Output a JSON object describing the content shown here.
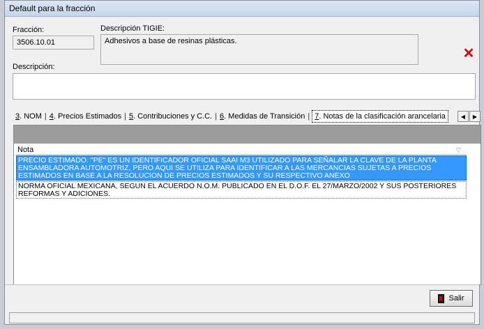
{
  "window": {
    "title": "Default para la fracción"
  },
  "fields": {
    "fraccion_label": "Fracción:",
    "fraccion_value": "3506.10.01",
    "descripcion_tigie_label": "Descripción TIGIE:",
    "descripcion_tigie_value": "Adhesivos a base de resinas plásticas.",
    "descripcion_label": "Descripción:",
    "descripcion_value": ""
  },
  "tabs": [
    {
      "key": "3",
      "label": ". NOM"
    },
    {
      "key": "4",
      "label": ". Precios Estimados"
    },
    {
      "key": "5",
      "label": ". Contribuciones y C.C."
    },
    {
      "key": "6",
      "label": ". Medidas de Transición"
    },
    {
      "key": "7",
      "label": ". Notas de la clasificación arancelaria"
    }
  ],
  "icons": {
    "close": "close-icon",
    "scroll_left": "arrow-left-icon",
    "scroll_right": "arrow-right-icon",
    "exit": "door-icon"
  },
  "grid": {
    "column_header": "Nota",
    "rows": [
      "PRECIO ESTIMADO.    \"PE\" ES UN IDENTIFICADOR OFICIAL SAAI M3 UTILIZADO PARA  SEÑALAR LA CLAVE DE LA PLANTA ENSAMBLADORA AUTOMOTRIZ, PERO AQUI SE UTILIZA PARA IDENTIFICAR A LAS MERCANCIAS  SUJETAS A PRECIOS ESTIMADOS EN BASE A LA RESOLUCION DE  PRECIOS ESTIMADOS Y SU RESPECTIVO ANEXO",
      "NORMA OFICIAL MEXICANA, SEGUN EL ACUERDO N.O.M. PUBLICADO  EN EL D.O.F. EL 27/MARZO/2002 Y SUS POSTERIORES REFORMAS  Y ADICIONES."
    ]
  },
  "buttons": {
    "salir": "Salir"
  },
  "colors": {
    "selected_row": "#3399ff",
    "close_red": "#d40000"
  }
}
